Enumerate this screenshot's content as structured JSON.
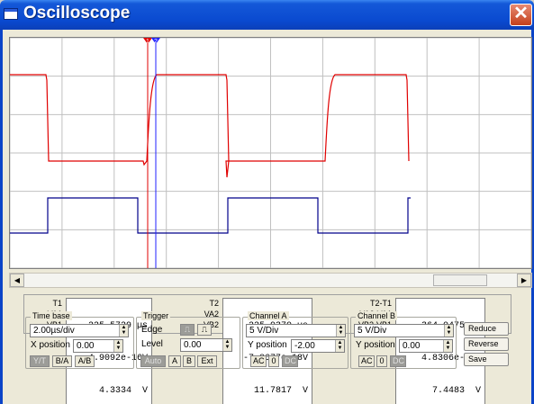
{
  "window": {
    "title": "Oscilloscope",
    "close_glyph": "✕"
  },
  "colors": {
    "channel_a": "#e00000",
    "channel_b": "#00008b",
    "cursor1": "#e00000",
    "cursor2": "#2020ff",
    "grid": "#c0c0c0"
  },
  "cursors": {
    "t1_label": "1",
    "t2_label": "2"
  },
  "readout": {
    "t1": {
      "labels": [
        "T1",
        "VA1",
        "VB1"
      ],
      "values": [
        "225.5729 µs",
        "-4.9092e-16V",
        "4.3334  V"
      ]
    },
    "t2": {
      "labels": [
        "T2",
        "VA2",
        "VB2"
      ],
      "values": [
        "225.9370 µs",
        "-7.8677e-18V",
        "11.7817  V"
      ]
    },
    "diff": {
      "labels": [
        "T2-T1",
        "VA2-VA1",
        "VB2-VB1"
      ],
      "values": [
        "364.0475 ns",
        "4.8306e-16V",
        "7.4483  V"
      ]
    }
  },
  "timebase": {
    "title": "Time base",
    "scale": "2.00µs/div",
    "xpos_label": "X position",
    "xpos": "0.00",
    "modes": [
      "Y/T",
      "B/A",
      "A/B"
    ],
    "active_mode": "Y/T"
  },
  "trigger": {
    "title": "Trigger",
    "edge_label": "Edge",
    "level_label": "Level",
    "level": "0.00",
    "buttons": [
      "Auto",
      "A",
      "B",
      "Ext"
    ],
    "active": "Auto"
  },
  "channel_a": {
    "title": "Channel A",
    "scale": "5  V/Div",
    "ypos_label": "Y position",
    "ypos": "-2.00",
    "coupling": [
      "AC",
      "0",
      "DC"
    ],
    "active": "DC"
  },
  "channel_b": {
    "title": "Channel B",
    "scale": "5  V/Div",
    "ypos_label": "Y position",
    "ypos": "0.00",
    "coupling": [
      "AC",
      "0",
      "DC"
    ],
    "active": "DC"
  },
  "actions": {
    "reduce": "Reduce",
    "reverse": "Reverse",
    "save": "Save"
  }
}
